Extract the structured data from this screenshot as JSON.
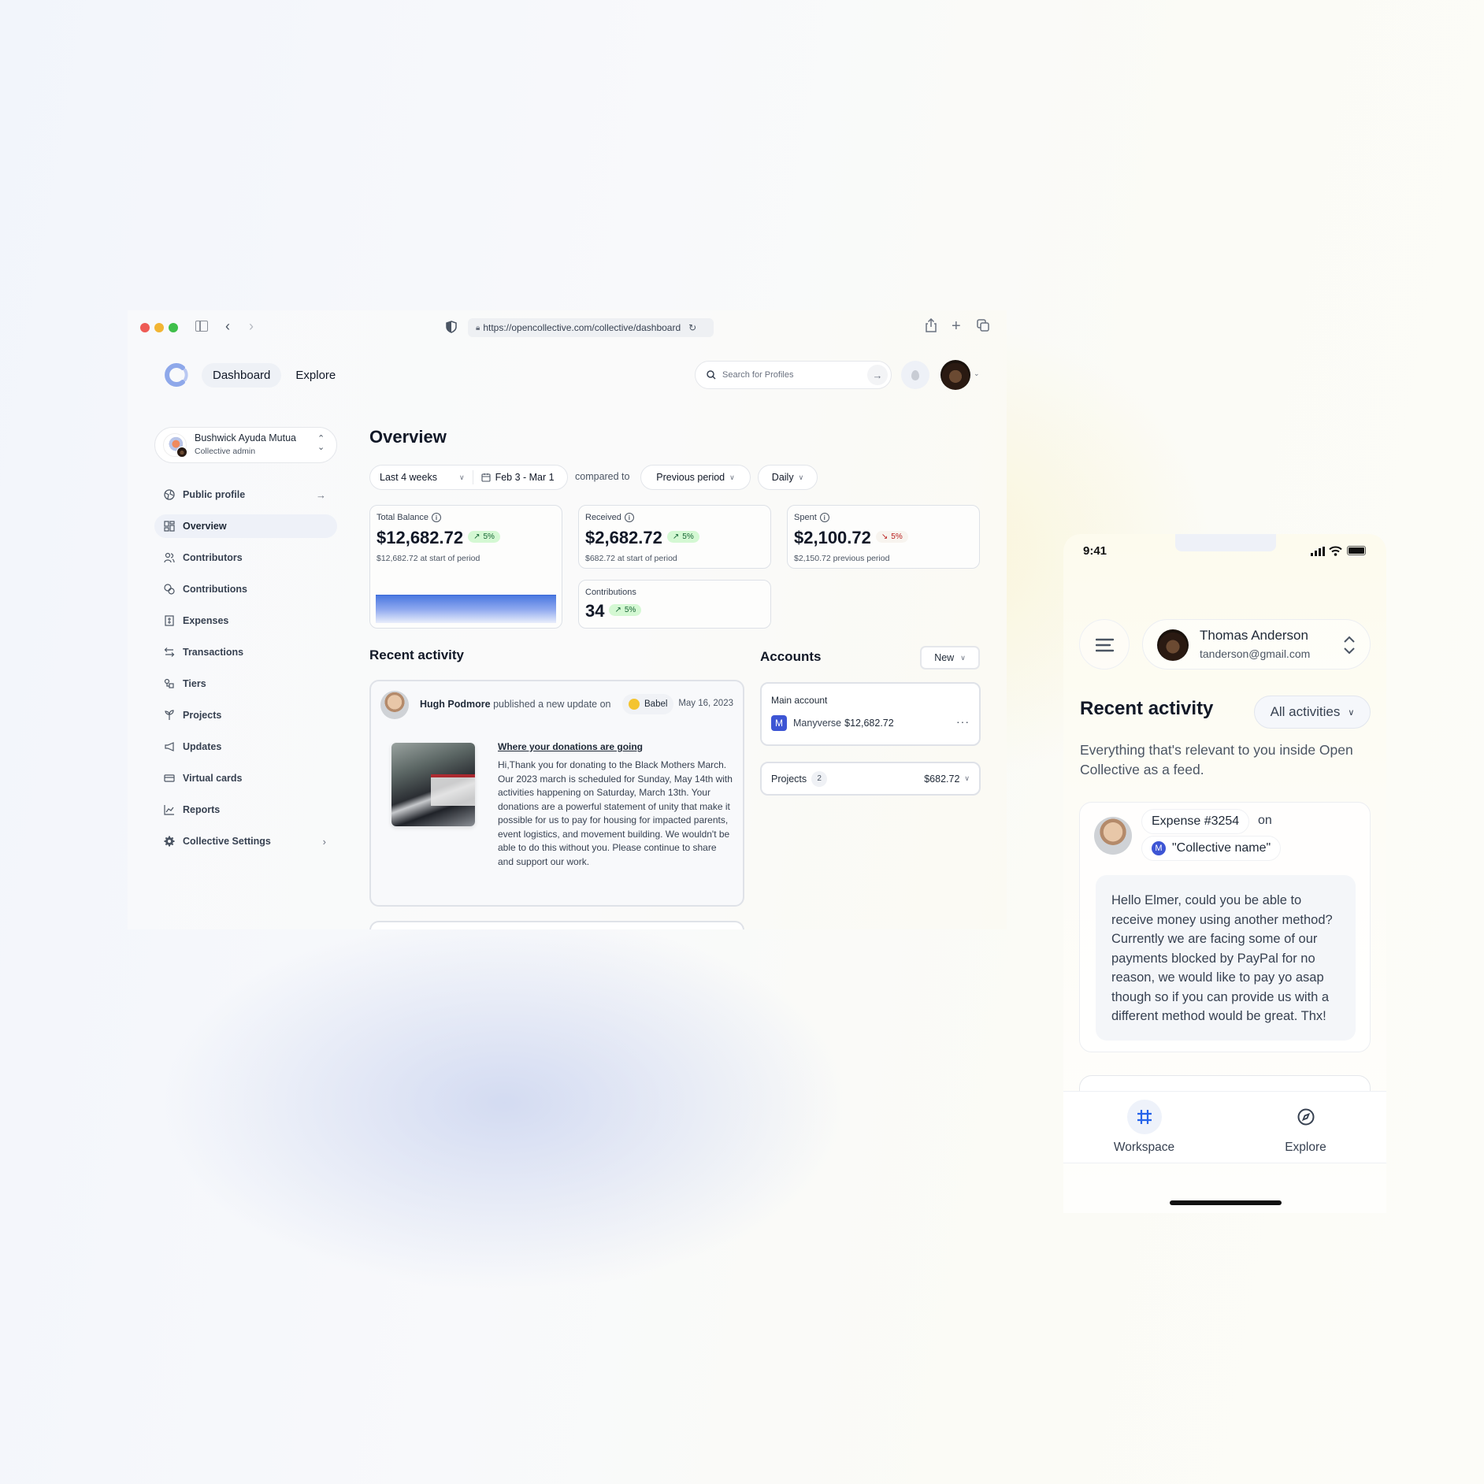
{
  "browser": {
    "url": "https://opencollective.com/collective/dashboard",
    "nav": {
      "dashboard": "Dashboard",
      "explore": "Explore"
    },
    "search": {
      "placeholder": "Search for Profiles"
    },
    "icons": [
      "sidebar-icon",
      "back-icon",
      "forward-icon",
      "shield-icon",
      "lock-icon",
      "reload-icon",
      "share-icon",
      "new-tab-icon",
      "tabs-icon"
    ]
  },
  "sidebar": {
    "collective": {
      "name": "Bushwick Ayuda Mutua",
      "role": "Collective admin"
    },
    "items": [
      {
        "label": "Public profile",
        "icon": "globe-icon",
        "trail": "→"
      },
      {
        "label": "Overview",
        "icon": "grid-icon",
        "active": true
      },
      {
        "label": "Contributors",
        "icon": "users-icon"
      },
      {
        "label": "Contributions",
        "icon": "coins-icon"
      },
      {
        "label": "Expenses",
        "icon": "receipt-icon"
      },
      {
        "label": "Transactions",
        "icon": "arrows-icon"
      },
      {
        "label": "Tiers",
        "icon": "tiers-icon"
      },
      {
        "label": "Projects",
        "icon": "sprout-icon"
      },
      {
        "label": "Updates",
        "icon": "megaphone-icon"
      },
      {
        "label": "Virtual cards",
        "icon": "card-icon"
      },
      {
        "label": "Reports",
        "icon": "chart-icon"
      },
      {
        "label": "Collective Settings",
        "icon": "gear-icon",
        "trail": "›"
      }
    ]
  },
  "overview": {
    "title": "Overview",
    "filters": {
      "range": "Last 4 weeks",
      "dates": "Feb 3 - Mar 1",
      "compared_to": "compared to",
      "comparison": "Previous period",
      "interval": "Daily"
    },
    "stats": {
      "total_balance": {
        "label": "Total Balance",
        "value": "$12,682.72",
        "change": "5%",
        "direction": "up",
        "sub": "$12,682.72 at start of period"
      },
      "received": {
        "label": "Received",
        "value": "$2,682.72",
        "change": "5%",
        "direction": "up",
        "sub": "$682.72 at start of period"
      },
      "spent": {
        "label": "Spent",
        "value": "$2,100.72",
        "change": "5%",
        "direction": "down",
        "sub": "$2,150.72 previous period"
      },
      "contributions": {
        "label": "Contributions",
        "value": "34",
        "change": "5%",
        "direction": "up"
      }
    }
  },
  "recent_activity": {
    "title": "Recent activity",
    "items": [
      {
        "author": "Hugh Podmore",
        "action": "published a new update on",
        "collective": "Babel",
        "date": "May 16, 2023",
        "update_title": "Where your donations are going",
        "update_body": "Hi,Thank you for donating to the Black Mothers March. Our 2023 march is scheduled for Sunday, May 14th with activities happening on Saturday, March 13th. Your donations are a powerful statement of unity that make it possible for us to pay for housing for impacted parents, event logistics, and movement building. We wouldn't be able to do this without you. Please continue to share and support our work."
      }
    ]
  },
  "accounts": {
    "title": "Accounts",
    "new_label": "New",
    "main": {
      "label": "Main account",
      "name": "Manyverse",
      "amount": "$12,682.72",
      "logo_letter": "M"
    },
    "projects": {
      "label": "Projects",
      "count": "2",
      "amount": "$682.72"
    }
  },
  "mobile": {
    "status": {
      "time": "9:41"
    },
    "user": {
      "name": "Thomas Anderson",
      "email": "tanderson@gmail.com"
    },
    "activity": {
      "title": "Recent activity",
      "filter": "All activities",
      "description": "Everything that's relevant to you inside Open Collective as a feed.",
      "item": {
        "expense": "Expense #3254",
        "on": "on",
        "collective": "\"Collective name\"",
        "collective_letter": "M",
        "message": "Hello Elmer, could you be able to receive money using another method? Currently we are facing some of our payments blocked by PayPal for no reason, we would like to pay yo asap though so if you can provide us with a different method would be great. Thx!"
      }
    },
    "tabs": [
      {
        "label": "Workspace",
        "icon": "hash-icon",
        "active": true
      },
      {
        "label": "Explore",
        "icon": "compass-icon"
      }
    ]
  },
  "colors": {
    "accent": "#1f6feb",
    "positive_bg": "#d4f8d3",
    "negative": "#b91c1c",
    "manyverse": "#3d55d4"
  }
}
